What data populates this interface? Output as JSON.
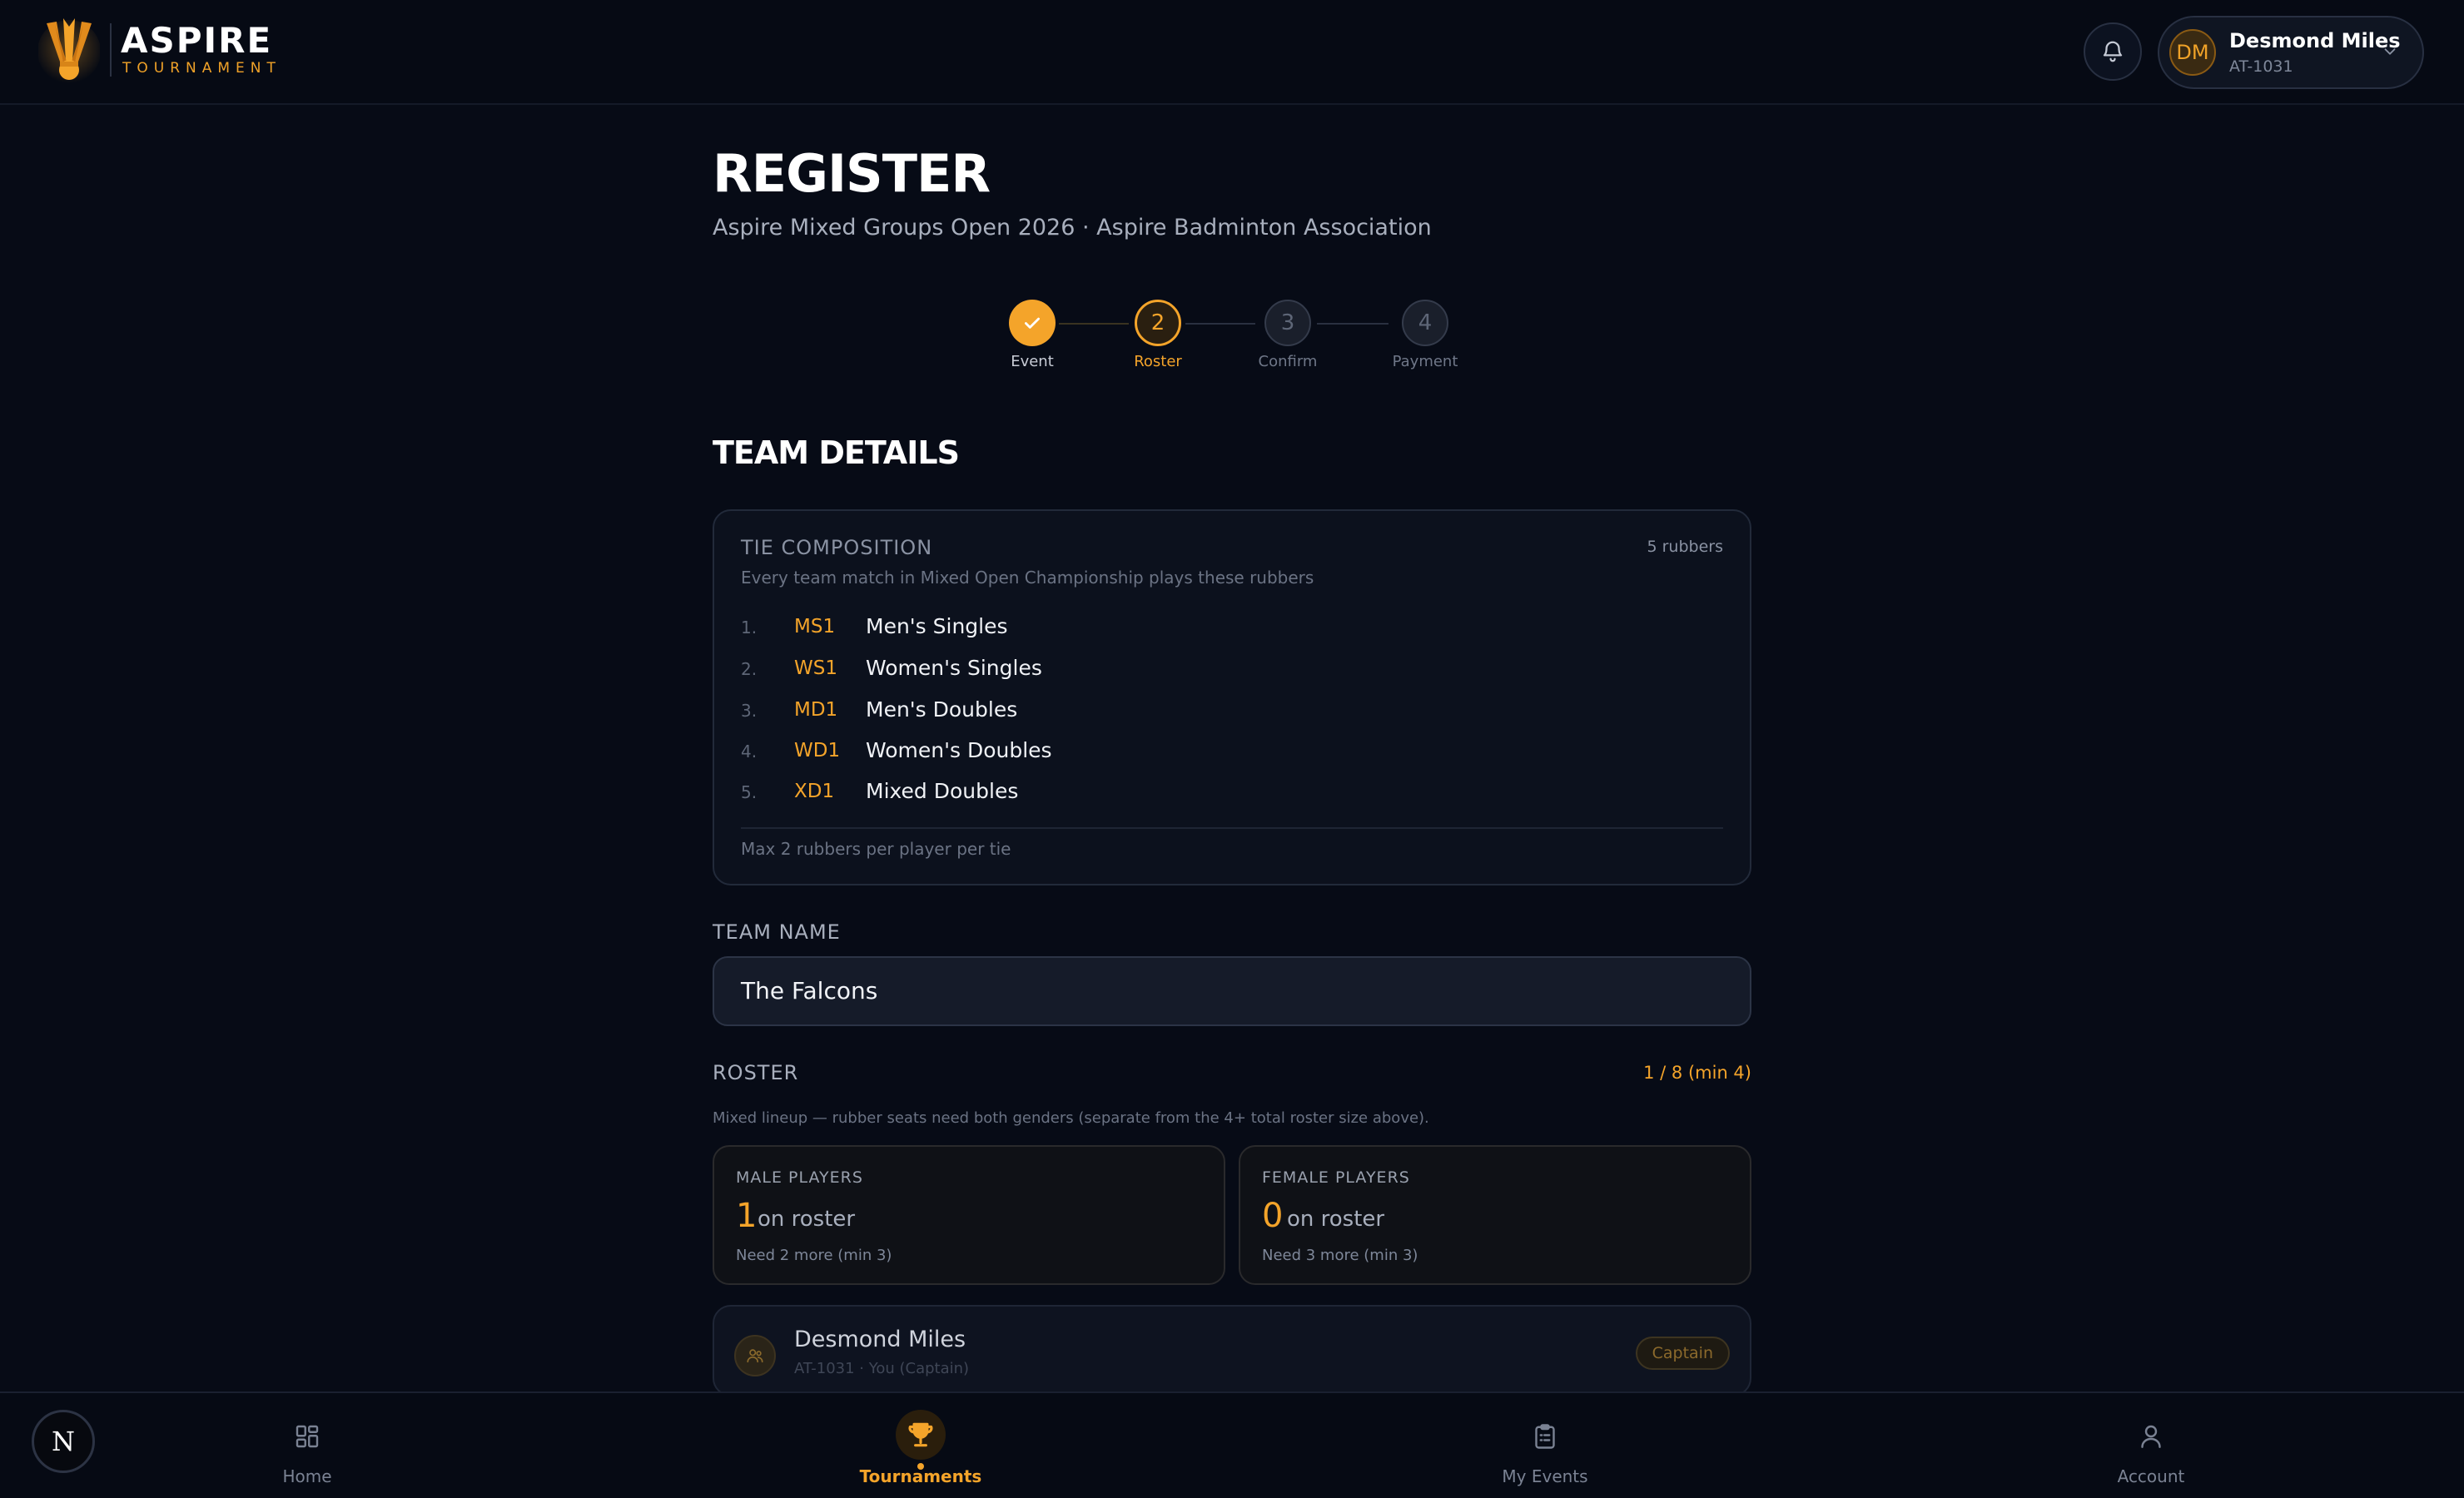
{
  "brand": {
    "name": "ASPIRE",
    "tagline": "TOURNAMENT"
  },
  "user": {
    "initials": "DM",
    "name": "Desmond Miles",
    "id": "AT-1031"
  },
  "page": {
    "title": "REGISTER",
    "subtitle": "Aspire Mixed Groups Open 2026 · Aspire Badminton Association"
  },
  "steps": [
    {
      "label": "Event",
      "number": "1",
      "state": "done"
    },
    {
      "label": "Roster",
      "number": "2",
      "state": "active"
    },
    {
      "label": "Confirm",
      "number": "3",
      "state": "pending"
    },
    {
      "label": "Payment",
      "number": "4",
      "state": "pending"
    }
  ],
  "team_details": {
    "title": "TEAM DETAILS",
    "tie": {
      "title": "TIE COMPOSITION",
      "count": "5 rubbers",
      "description": "Every team match in Mixed Open Championship plays these rubbers",
      "rubbers": [
        {
          "index": "1.",
          "code": "MS1",
          "name": "Men's Singles"
        },
        {
          "index": "2.",
          "code": "WS1",
          "name": "Women's Singles"
        },
        {
          "index": "3.",
          "code": "MD1",
          "name": "Men's Doubles"
        },
        {
          "index": "4.",
          "code": "WD1",
          "name": "Women's Doubles"
        },
        {
          "index": "5.",
          "code": "XD1",
          "name": "Mixed Doubles"
        }
      ],
      "footer": "Max 2 rubbers per player per tie"
    },
    "team_name": {
      "label": "TEAM NAME",
      "value": "The Falcons"
    },
    "roster": {
      "label": "ROSTER",
      "count": "1 / 8 (min 4)",
      "note": "Mixed lineup — rubber seats need both genders (separate from the 4+ total roster size above).",
      "male": {
        "title": "MALE PLAYERS",
        "count": "1",
        "suffix": "on roster",
        "need": "Need 2 more (min 3)"
      },
      "female": {
        "title": "FEMALE PLAYERS",
        "count": "0",
        "suffix": "on roster",
        "need": "Need 3 more (min 3)"
      },
      "members": [
        {
          "name": "Desmond Miles",
          "sub": "AT-1031 · You (Captain)",
          "badge": "Captain"
        }
      ]
    }
  },
  "nav": {
    "badge": "N",
    "items": [
      {
        "label": "Home",
        "icon": "grid-icon"
      },
      {
        "label": "Tournaments",
        "icon": "trophy-icon",
        "active": true
      },
      {
        "label": "My Events",
        "icon": "clipboard-icon"
      },
      {
        "label": "Account",
        "icon": "person-icon"
      }
    ]
  },
  "colors": {
    "accent": "#f4a42a",
    "background": "#070b16",
    "card": "#0c111d"
  }
}
